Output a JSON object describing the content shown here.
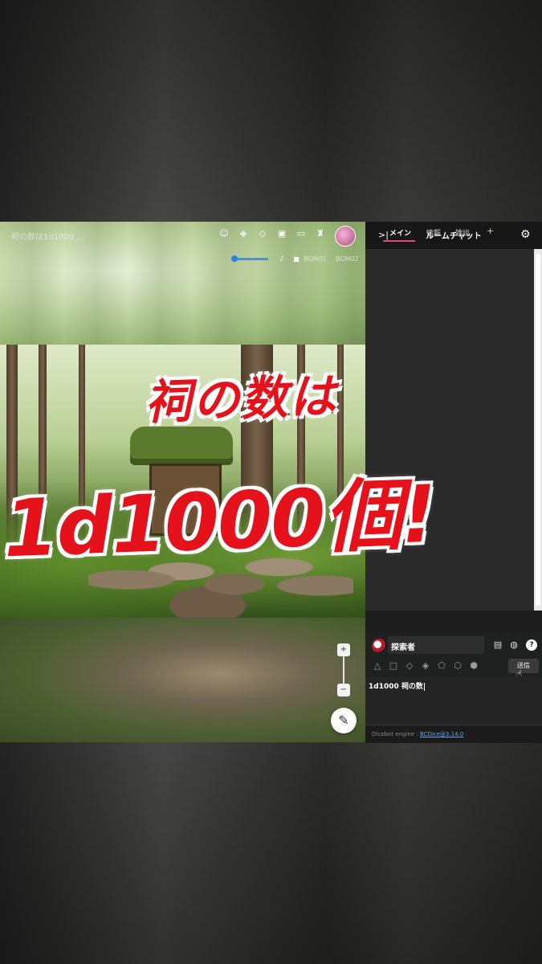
{
  "board": {
    "room_title": "祠の数は1d1000 …",
    "bgm_label_1": "BGM01",
    "bgm_label_2": "BGM02",
    "icons": {
      "smile": "face-icon",
      "layers": "layers-icon",
      "layers2": "stack-icon",
      "message": "message-icon",
      "screen": "screen-icon",
      "castle": "castle-icon",
      "volume": "volume-icon",
      "stop": "stop-icon",
      "zoom_in": "zoom-in-icon",
      "zoom_out": "zoom-out-icon",
      "pencil": "pencil-icon"
    }
  },
  "caption": {
    "line1": "祠の数は",
    "line2": "1d1000個!"
  },
  "chat": {
    "collapse_glyph": ">|",
    "title": "ルームチャット",
    "tabs": [
      {
        "label": "メイン",
        "active": true
      },
      {
        "label": "情報",
        "active": false
      },
      {
        "label": "雑談",
        "active": false
      },
      {
        "label": "+",
        "active": false
      }
    ],
    "character_name": "探索者",
    "send_label": "送信",
    "input_text": "1d1000 祠の数",
    "footer_prefix": "Dicebot engine : ",
    "footer_link": "BCDice@3.14.0",
    "colors": {
      "accent": "#e0467a",
      "caption_red": "#e5121b"
    }
  }
}
